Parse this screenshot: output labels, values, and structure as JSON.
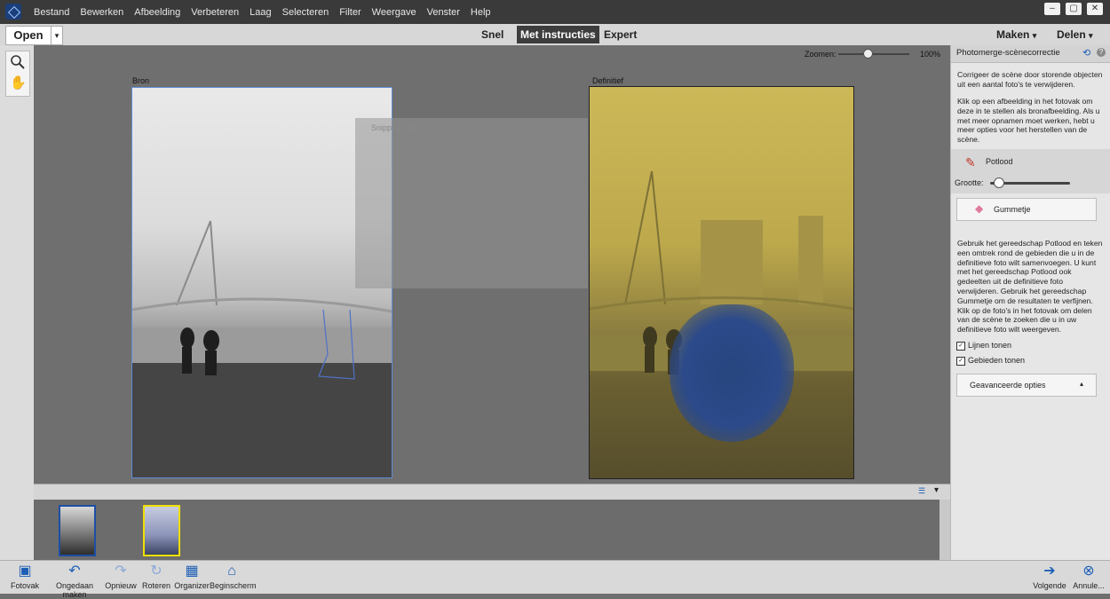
{
  "menubar": {
    "items": [
      "Bestand",
      "Bewerken",
      "Afbeelding",
      "Verbeteren",
      "Laag",
      "Selecteren",
      "Filter",
      "Weergave",
      "Venster",
      "Help"
    ]
  },
  "toolbar": {
    "open_label": "Open",
    "modes": {
      "quick": "Snel",
      "guided": "Met instructies",
      "expert": "Expert"
    },
    "create_label": "Maken",
    "share_label": "Delen"
  },
  "canvas": {
    "zoom_label": "Zoomen:",
    "zoom_value": "100%",
    "source_label": "Bron",
    "final_label": "Definitief",
    "ghost_text": "Snipping Tool"
  },
  "panel": {
    "title": "Photomerge-scènecorrectie",
    "intro": "Corrigeer de scène door storende objecten uit een aantal foto's te verwijderen.",
    "instruction": "Klik op een afbeelding in het fotovak om deze in te stellen als bronafbeelding. Als u met meer opnamen moet werken, hebt u meer opties voor het herstellen van de scène.",
    "pencil_label": "Potlood",
    "size_label": "Grootte:",
    "eraser_label": "Gummetje",
    "help_text": "Gebruik het gereedschap Potlood en teken een omtrek rond de gebieden die u in de definitieve foto wilt samenvoegen. U kunt met het gereedschap Potlood ook gedeelten uit de definitieve foto verwijderen. Gebruik het gereedschap Gummetje om de resultaten te verfijnen. Klik op de foto's in het fotovak om delen van de scène te zoeken die u in uw definitieve foto wilt weergeven.",
    "show_lines": "Lijnen tonen",
    "show_regions": "Gebieden tonen",
    "advanced": "Geavanceerde opties"
  },
  "bottombar": {
    "photobin": "Fotovak",
    "undo": "Ongedaan maken",
    "redo": "Opnieuw",
    "rotate": "Roteren",
    "organizer": "Organizer",
    "home": "Beginscherm",
    "next": "Volgende",
    "cancel": "Annule..."
  }
}
